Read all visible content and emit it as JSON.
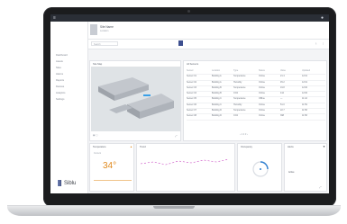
{
  "app": {
    "brand": "Siblu",
    "site_name": "Site Name",
    "site_sub": "Location",
    "search_placeholder": "Search"
  },
  "sidebar": {
    "items": [
      {
        "label": "Dashboard"
      },
      {
        "label": "Assets"
      },
      {
        "label": "Sites"
      },
      {
        "label": "Alarms"
      },
      {
        "label": "Reports"
      },
      {
        "label": "Devices"
      },
      {
        "label": "Analytics"
      },
      {
        "label": "Settings"
      }
    ]
  },
  "panels": {
    "map_title": "Site Map",
    "table_title": "All Sensors",
    "table": {
      "headers": [
        "Sensor",
        "Location",
        "Type",
        "Status",
        "Value",
        "Updated"
      ],
      "rows": [
        [
          "Sensor 01",
          "Building A",
          "Temperature",
          "Online",
          "21.4",
          "12:01"
        ],
        [
          "Sensor 02",
          "Building A",
          "Humidity",
          "Online",
          "45.2",
          "12:01"
        ],
        [
          "Sensor 03",
          "Building B",
          "Temperature",
          "Online",
          "19.8",
          "12:00"
        ],
        [
          "Sensor 04",
          "Building B",
          "CO2",
          "Online",
          "412",
          "12:00"
        ],
        [
          "Sensor 05",
          "Building C",
          "Temperature",
          "Offline",
          "—",
          "11:42"
        ],
        [
          "Sensor 06",
          "Building C",
          "Humidity",
          "Online",
          "51.0",
          "11:59"
        ],
        [
          "Sensor 07",
          "Building D",
          "Temperature",
          "Online",
          "22.7",
          "11:58"
        ],
        [
          "Sensor 08",
          "Building D",
          "CO2",
          "Online",
          "398",
          "11:58"
        ]
      ]
    },
    "temp_title": "Temperature",
    "temp_value": "34°",
    "temp_label": "Current",
    "trend_title": "Trend",
    "gauge_title": "Occupancy",
    "side_title": "Alerts",
    "side_value": "Active"
  },
  "colors": {
    "accent": "#e08a1e",
    "brand": "#2b3a67",
    "highlight": "#3aa0e8"
  }
}
